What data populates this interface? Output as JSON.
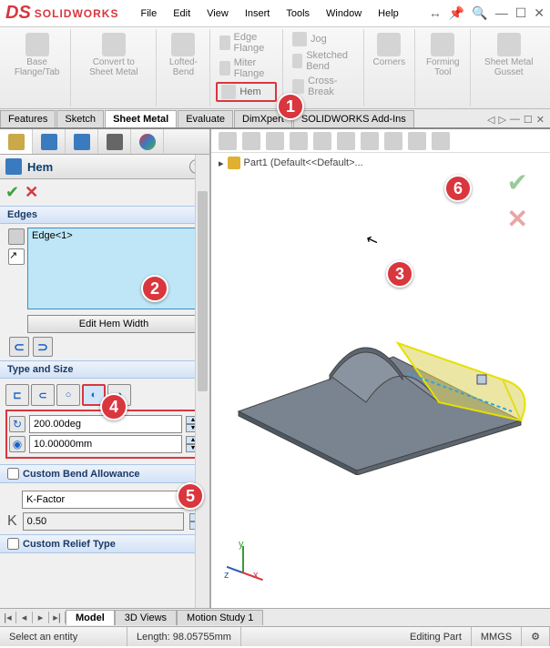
{
  "app": {
    "brand_mark": "DS",
    "brand_name": "SOLIDWORKS"
  },
  "menu": {
    "file": "File",
    "edit": "Edit",
    "view": "View",
    "insert": "Insert",
    "tools": "Tools",
    "window": "Window",
    "help": "Help"
  },
  "ribbon": {
    "base": "Base Flange/Tab",
    "convert": "Convert to Sheet Metal",
    "lofted": "Lofted-Bend",
    "edge_flange": "Edge Flange",
    "miter": "Miter Flange",
    "hem": "Hem",
    "jog": "Jog",
    "sketched_bend": "Sketched Bend",
    "cross_break": "Cross-Break",
    "corners": "Corners",
    "forming": "Forming Tool",
    "gusset": "Sheet Metal Gusset"
  },
  "cmd_tabs": {
    "features": "Features",
    "sketch": "Sketch",
    "sheet_metal": "Sheet Metal",
    "evaluate": "Evaluate",
    "dimxpert": "DimXpert",
    "addins": "SOLIDWORKS Add-Ins"
  },
  "feature": {
    "title": "Hem",
    "edges_hdr": "Edges",
    "edge_item": "Edge<1>",
    "edit_hem": "Edit Hem Width",
    "type_hdr": "Type and Size",
    "angle_val": "200.00deg",
    "radius_val": "10.00000mm",
    "cba_hdr": "Custom Bend Allowance",
    "kfactor_opt": "K-Factor",
    "k_label": "K",
    "k_val": "0.50",
    "crt_hdr": "Custom Relief Type"
  },
  "tree": {
    "root": "Part1 (Default<<Default>..."
  },
  "bottom_tabs": {
    "model": "Model",
    "views3d": "3D Views",
    "motion": "Motion Study 1"
  },
  "status": {
    "prompt": "Select an entity",
    "length": "Length: 98.05755mm",
    "mode": "Editing Part",
    "units": "MMGS"
  },
  "callouts": {
    "c1": "1",
    "c2": "2",
    "c3": "3",
    "c4": "4",
    "c5": "5",
    "c6": "6"
  },
  "triad": {
    "x": "x",
    "y": "y",
    "z": "z"
  }
}
